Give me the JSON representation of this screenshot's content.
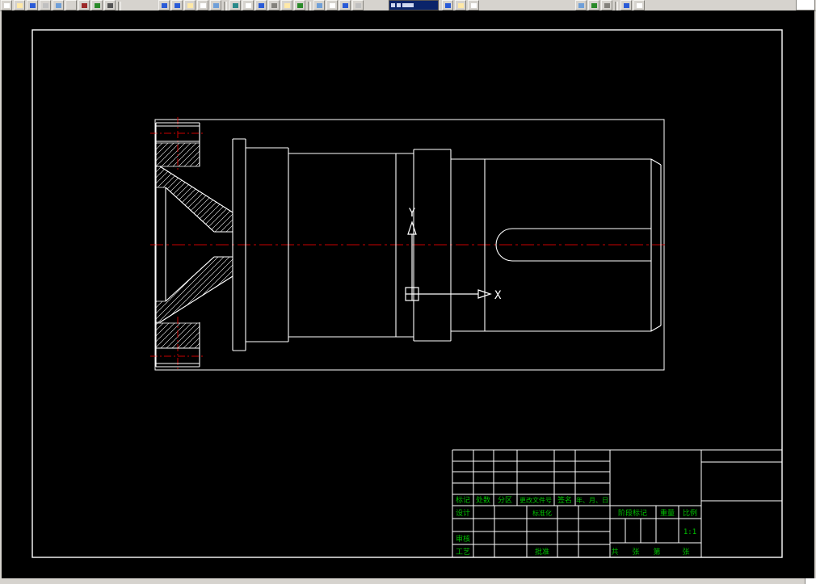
{
  "ucs": {
    "x_label": "X",
    "y_label": "Y"
  },
  "title_block": {
    "revision_header": [
      "标记",
      "处数",
      "分区",
      "更改文件号",
      "签名",
      "年、月、日"
    ],
    "design_label": "设计",
    "standardization_label": "标准化",
    "review_label": "审核",
    "process_label": "工艺",
    "approve_label": "批准",
    "stage_mark_label": "阶段标记",
    "weight_label": "重量",
    "scale_label": "比例",
    "scale_value": "1:1",
    "sheet_total_label": "共",
    "sheet_total_unit": "张",
    "sheet_page_label": "第",
    "sheet_page_unit": "张"
  },
  "colors": {
    "canvas_bg": "#000000",
    "drawing_line": "#ffffff",
    "centerline": "#c80000",
    "title_text": "#00c000"
  }
}
